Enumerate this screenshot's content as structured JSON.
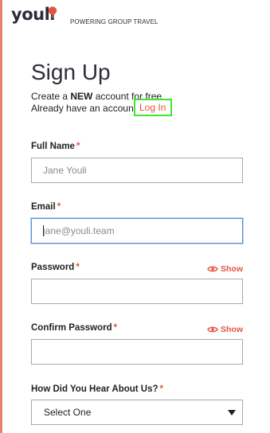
{
  "brand": {
    "logo_text": "youli",
    "tagline": "POWERING GROUP TRAVEL",
    "accent_color": "#e2553d",
    "logo_color": "#2d2d3a"
  },
  "page": {
    "title": "Sign Up",
    "intro_prefix": "Create a ",
    "intro_emphasis": "NEW",
    "intro_suffix": " account for free",
    "login_prompt": "Already have an account? ",
    "login_link": "Log In"
  },
  "form": {
    "required_mark": "*",
    "full_name": {
      "label": "Full Name",
      "placeholder": "Jane Youli",
      "value": ""
    },
    "email": {
      "label": "Email",
      "placeholder": "jane@youli.team",
      "value": ""
    },
    "password": {
      "label": "Password",
      "show_label": "Show",
      "value": ""
    },
    "confirm_password": {
      "label": "Confirm Password",
      "show_label": "Show",
      "value": ""
    },
    "referral": {
      "label": "How Did You Hear About Us?",
      "selected": "Select One"
    }
  },
  "icons": {
    "logo": "balloon-icon",
    "show": "eye-icon",
    "dropdown": "caret-down-icon"
  }
}
